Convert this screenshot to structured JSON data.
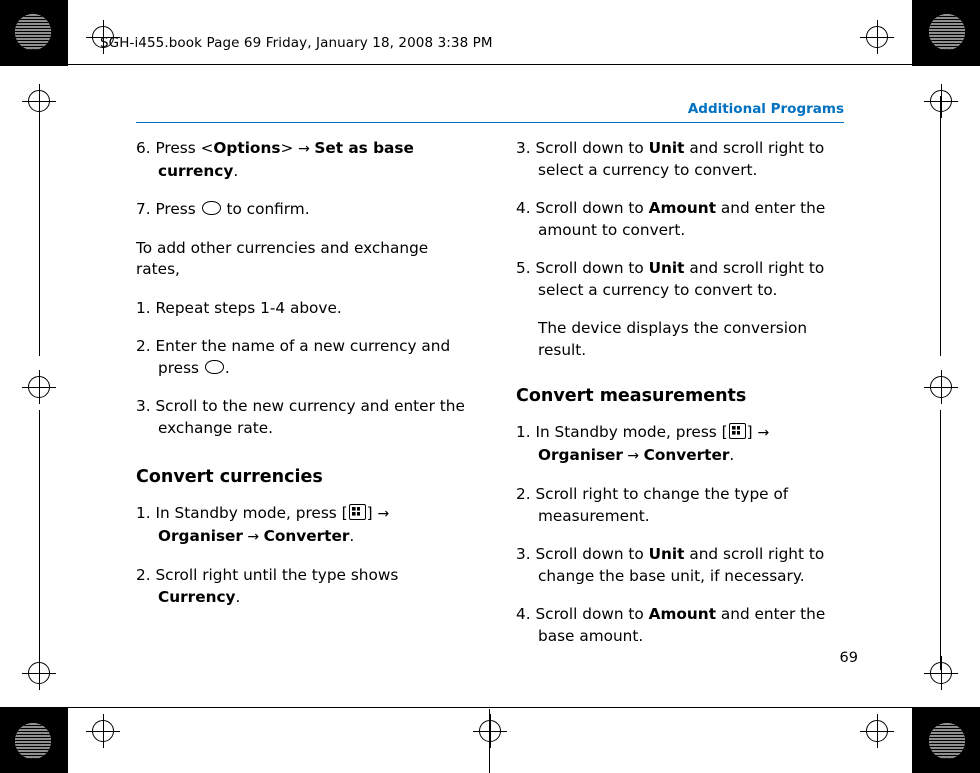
{
  "header": {
    "file_line": "SGH-i455.book  Page 69  Friday, January 18, 2008  3:38 PM",
    "section": "Additional Programs",
    "page_number": "69"
  },
  "left_column": {
    "blocks": [
      {
        "type": "step",
        "num": "6.",
        "parts": [
          {
            "t": "Press <"
          },
          {
            "t": "Options",
            "b": true
          },
          {
            "t": "> "
          },
          {
            "t": "→ ",
            "arrow": true
          },
          {
            "t": "Set as base currency",
            "b": true
          },
          {
            "t": "."
          }
        ]
      },
      {
        "type": "step",
        "num": "7.",
        "parts": [
          {
            "t": "Press "
          },
          {
            "t": "",
            "icon": "round-key"
          },
          {
            "t": " to confirm."
          }
        ]
      },
      {
        "type": "para",
        "parts": [
          {
            "t": "To add other currencies and exchange rates,"
          }
        ]
      },
      {
        "type": "step",
        "num": "1.",
        "parts": [
          {
            "t": "Repeat steps 1-4 above."
          }
        ]
      },
      {
        "type": "step",
        "num": "2.",
        "parts": [
          {
            "t": "Enter the name of a new currency and press "
          },
          {
            "t": "",
            "icon": "round-key"
          },
          {
            "t": "."
          }
        ]
      },
      {
        "type": "step",
        "num": "3.",
        "parts": [
          {
            "t": "Scroll to the new currency and enter the exchange rate."
          }
        ]
      },
      {
        "type": "heading",
        "parts": [
          {
            "t": "Convert currencies"
          }
        ]
      },
      {
        "type": "step",
        "num": "1.",
        "parts": [
          {
            "t": "In Standby mode, press ["
          },
          {
            "t": "",
            "icon": "menu-key"
          },
          {
            "t": "] "
          },
          {
            "t": "→ ",
            "arrow": true
          },
          {
            "t": "Organiser",
            "b": true
          },
          {
            "t": " → ",
            "arrow": true
          },
          {
            "t": "Converter",
            "b": true
          },
          {
            "t": "."
          }
        ]
      },
      {
        "type": "step",
        "num": "2.",
        "parts": [
          {
            "t": "Scroll right until the type shows "
          },
          {
            "t": "Currency",
            "b": true
          },
          {
            "t": "."
          }
        ]
      }
    ]
  },
  "right_column": {
    "blocks": [
      {
        "type": "step",
        "num": "3.",
        "parts": [
          {
            "t": "Scroll down to "
          },
          {
            "t": "Unit",
            "b": true
          },
          {
            "t": " and scroll right to select a currency to convert."
          }
        ]
      },
      {
        "type": "step",
        "num": "4.",
        "parts": [
          {
            "t": "Scroll down to "
          },
          {
            "t": "Amount",
            "b": true
          },
          {
            "t": " and enter the amount to convert."
          }
        ]
      },
      {
        "type": "step",
        "num": "5.",
        "parts": [
          {
            "t": "Scroll down to "
          },
          {
            "t": "Unit",
            "b": true
          },
          {
            "t": " and scroll right to select a currency to convert to."
          }
        ]
      },
      {
        "type": "indent",
        "parts": [
          {
            "t": "The device displays the conversion result."
          }
        ]
      },
      {
        "type": "heading",
        "parts": [
          {
            "t": "Convert measurements"
          }
        ]
      },
      {
        "type": "step",
        "num": "1.",
        "parts": [
          {
            "t": "In Standby mode, press ["
          },
          {
            "t": "",
            "icon": "menu-key"
          },
          {
            "t": "] "
          },
          {
            "t": "→ ",
            "arrow": true
          },
          {
            "t": "Organiser",
            "b": true
          },
          {
            "t": " → ",
            "arrow": true
          },
          {
            "t": "Converter",
            "b": true
          },
          {
            "t": "."
          }
        ]
      },
      {
        "type": "step",
        "num": "2.",
        "parts": [
          {
            "t": "Scroll right to change the type of measurement."
          }
        ]
      },
      {
        "type": "step",
        "num": "3.",
        "parts": [
          {
            "t": "Scroll down to "
          },
          {
            "t": "Unit",
            "b": true
          },
          {
            "t": " and scroll right to change the base unit, if necessary."
          }
        ]
      },
      {
        "type": "step",
        "num": "4.",
        "parts": [
          {
            "t": "Scroll down to "
          },
          {
            "t": "Amount",
            "b": true
          },
          {
            "t": " and enter the base amount."
          }
        ]
      }
    ]
  },
  "colors": {
    "accent": "#0070c0",
    "text": "#000000",
    "page": "#ffffff"
  }
}
